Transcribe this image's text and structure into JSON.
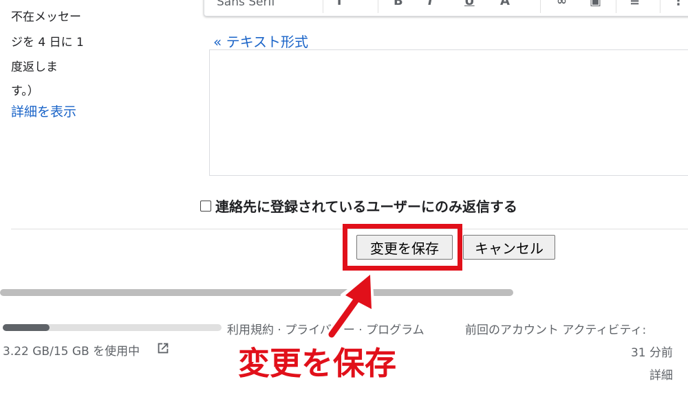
{
  "toolbar": {
    "font_name": "Sans Serif",
    "icons": [
      "text-size-icon",
      "bold-icon",
      "italic-icon",
      "underline-icon",
      "text-color-icon",
      "link-icon",
      "image-icon",
      "align-icon"
    ]
  },
  "left": {
    "lines": [
      "不在メッセー",
      "ジを 4 日に 1",
      "度返しま",
      "す。）"
    ],
    "show_details_link": "詳細を表示"
  },
  "editor": {
    "text_format_link": "« テキスト形式",
    "body": ""
  },
  "options": {
    "contacts_only_label": "連絡先に登録されているユーザーにのみ返信する",
    "contacts_only_checked": false
  },
  "actions": {
    "save_label": "変更を保存",
    "cancel_label": "キャンセル"
  },
  "storage": {
    "usage_text": "3.22 GB/15 GB を使用中",
    "used_fraction": 0.215
  },
  "footer": {
    "terms": "利用規約",
    "sep1": " · ",
    "privacy": "プライバシー",
    "sep2": " · ",
    "program": "プログラム",
    "activity_label": "前回のアカウント アクティビティ:",
    "activity_time": "31 分前",
    "details_link": "詳細"
  },
  "annotation": {
    "callout_text": "変更を保存",
    "color": "#e1101a"
  }
}
